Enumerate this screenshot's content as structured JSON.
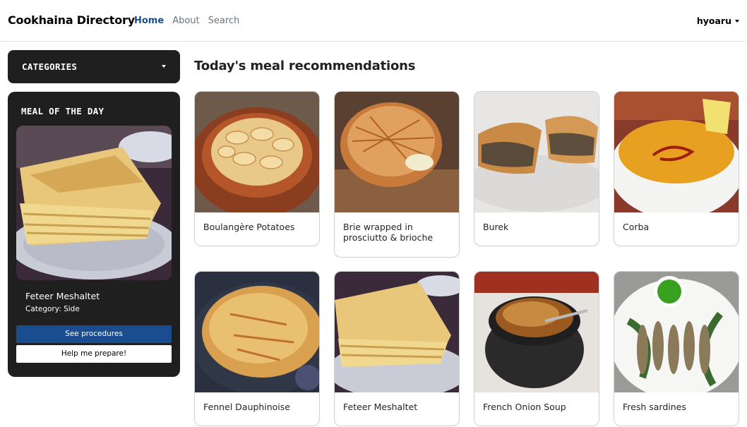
{
  "navbar": {
    "brand": "Cookhaina Directory",
    "links": [
      {
        "label": "Home",
        "active": true
      },
      {
        "label": "About",
        "active": false
      },
      {
        "label": "Search",
        "active": false
      }
    ],
    "user": "hyoaru"
  },
  "sidebar": {
    "categories_label": "CATEGORIES",
    "meal_of_the_day": {
      "title": "MEAL OF THE DAY",
      "name": "Feteer Meshaltet",
      "category": "Category: Side",
      "primary_button": "See procedures",
      "secondary_button": "Help me prepare!"
    }
  },
  "main": {
    "title": "Today's meal recommendations",
    "meals": [
      {
        "name": "Boulangère Potatoes"
      },
      {
        "name": "Brie wrapped in prosciutto & brioche"
      },
      {
        "name": "Burek"
      },
      {
        "name": "Corba"
      },
      {
        "name": "Fennel Dauphinoise"
      },
      {
        "name": "Feteer Meshaltet"
      },
      {
        "name": "French Onion Soup"
      },
      {
        "name": "Fresh sardines"
      }
    ]
  },
  "colors": {
    "accent": "#1a4d8f",
    "panel": "#1f1f1f"
  }
}
